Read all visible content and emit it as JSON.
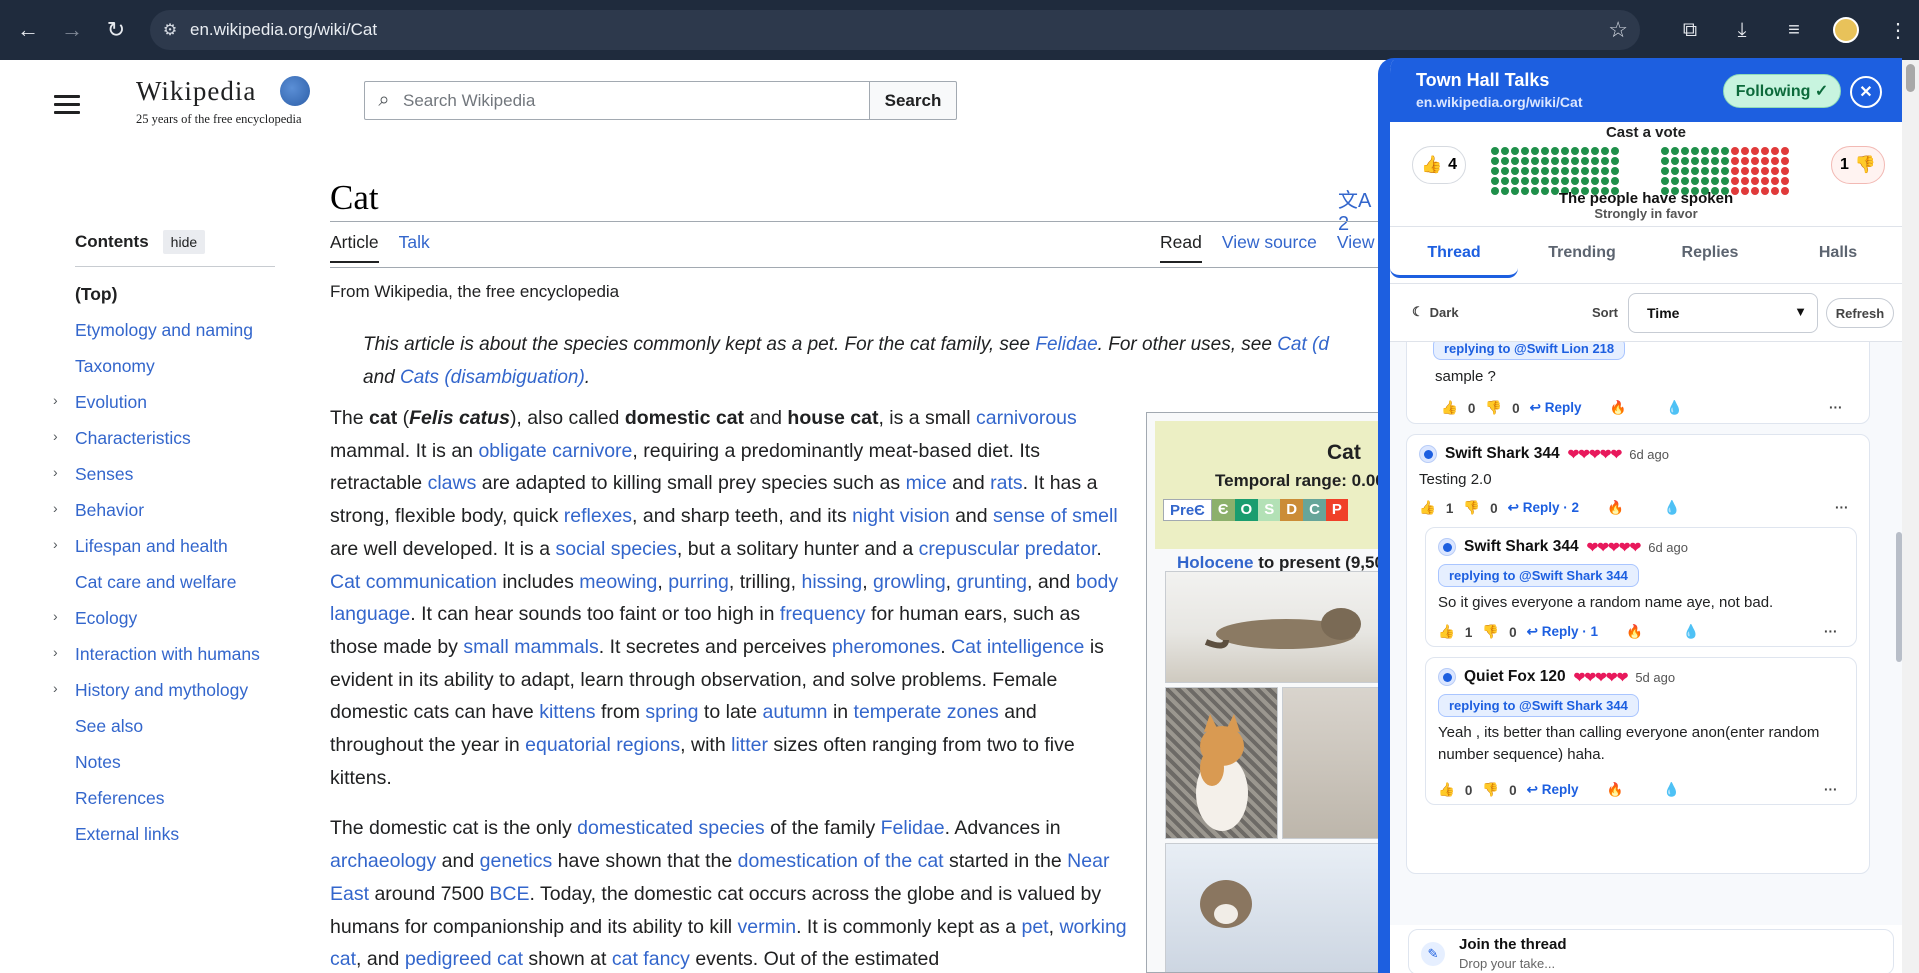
{
  "browser": {
    "url": "en.wikipedia.org/wiki/Cat"
  },
  "wiki": {
    "logo_word": "Wikipedia",
    "logo_tagline": "25 years of the free encyclopedia",
    "search_placeholder": "Search Wikipedia",
    "search_button": "Search",
    "toc": {
      "title": "Contents",
      "hide": "hide",
      "items": [
        {
          "label": "(Top)",
          "expandable": false
        },
        {
          "label": "Etymology and naming",
          "expandable": false
        },
        {
          "label": "Taxonomy",
          "expandable": false
        },
        {
          "label": "Evolution",
          "expandable": true
        },
        {
          "label": "Characteristics",
          "expandable": true
        },
        {
          "label": "Senses",
          "expandable": true
        },
        {
          "label": "Behavior",
          "expandable": true
        },
        {
          "label": "Lifespan and health",
          "expandable": true
        },
        {
          "label": "Cat care and welfare",
          "expandable": false
        },
        {
          "label": "Ecology",
          "expandable": true
        },
        {
          "label": "Interaction with humans",
          "expandable": true
        },
        {
          "label": "History and mythology",
          "expandable": true
        },
        {
          "label": "See also",
          "expandable": false
        },
        {
          "label": "Notes",
          "expandable": false
        },
        {
          "label": "References",
          "expandable": false
        },
        {
          "label": "External links",
          "expandable": false
        }
      ]
    },
    "title": "Cat",
    "lang_count": "2",
    "tabs_left": [
      "Article",
      "Talk"
    ],
    "tabs_right": [
      "Read",
      "View source",
      "View"
    ],
    "from": "From Wikipedia, the free encyclopedia",
    "hatnote": {
      "t1": "This article is about the species commonly kept as a pet. For the cat family, see ",
      "l1": "Felidae",
      "t2": ". For other uses, see ",
      "l2": "Cat (d",
      "t3": "and ",
      "l3": "Cats (disambiguation)",
      "t4": "."
    },
    "infobox": {
      "title": "Cat",
      "range": "Temporal range: 0.00",
      "geo": [
        "PreЄ",
        "Є",
        "O",
        "S",
        "D",
        "C",
        "P"
      ],
      "holo_link": "Holocene",
      "holo_rest": " to present (9,50"
    }
  },
  "townhall": {
    "name": "Town Hall Talks",
    "url": "en.wikipedia.org/wiki/Cat",
    "follow": "Following ✓",
    "vote_title": "Cast a vote",
    "up_count": "4",
    "down_count": "1",
    "vote_status": "The people have spoken",
    "vote_sub": "Strongly in favor",
    "tabs": [
      "Thread",
      "Trending",
      "Replies",
      "Halls"
    ],
    "dark_label": "Dark",
    "sort_label": "Sort",
    "sort_value": "Time",
    "refresh": "Refresh",
    "comments": [
      {
        "reply_to": "replying to @Swift Lion 218",
        "text": "sample ?",
        "up": "0",
        "down": "0",
        "reply": "Reply"
      },
      {
        "author": "Swift Shark 344",
        "ago": "6d ago",
        "text": "Testing 2.0",
        "up": "1",
        "down": "0",
        "reply": "Reply · 2"
      },
      {
        "author": "Swift Shark 344",
        "ago": "6d ago",
        "reply_to": "replying to @Swift Shark 344",
        "text": "So it gives everyone a random name aye, not bad.",
        "up": "1",
        "down": "0",
        "reply": "Reply · 1"
      },
      {
        "author": "Quiet Fox 120",
        "ago": "5d ago",
        "reply_to": "replying to @Swift Shark 344",
        "text": "Yeah , its better than calling everyone anon(enter random number sequence)  haha.",
        "up": "0",
        "down": "0",
        "reply": "Reply"
      }
    ],
    "join_title": "Join the thread",
    "join_sub": "Drop your take..."
  }
}
